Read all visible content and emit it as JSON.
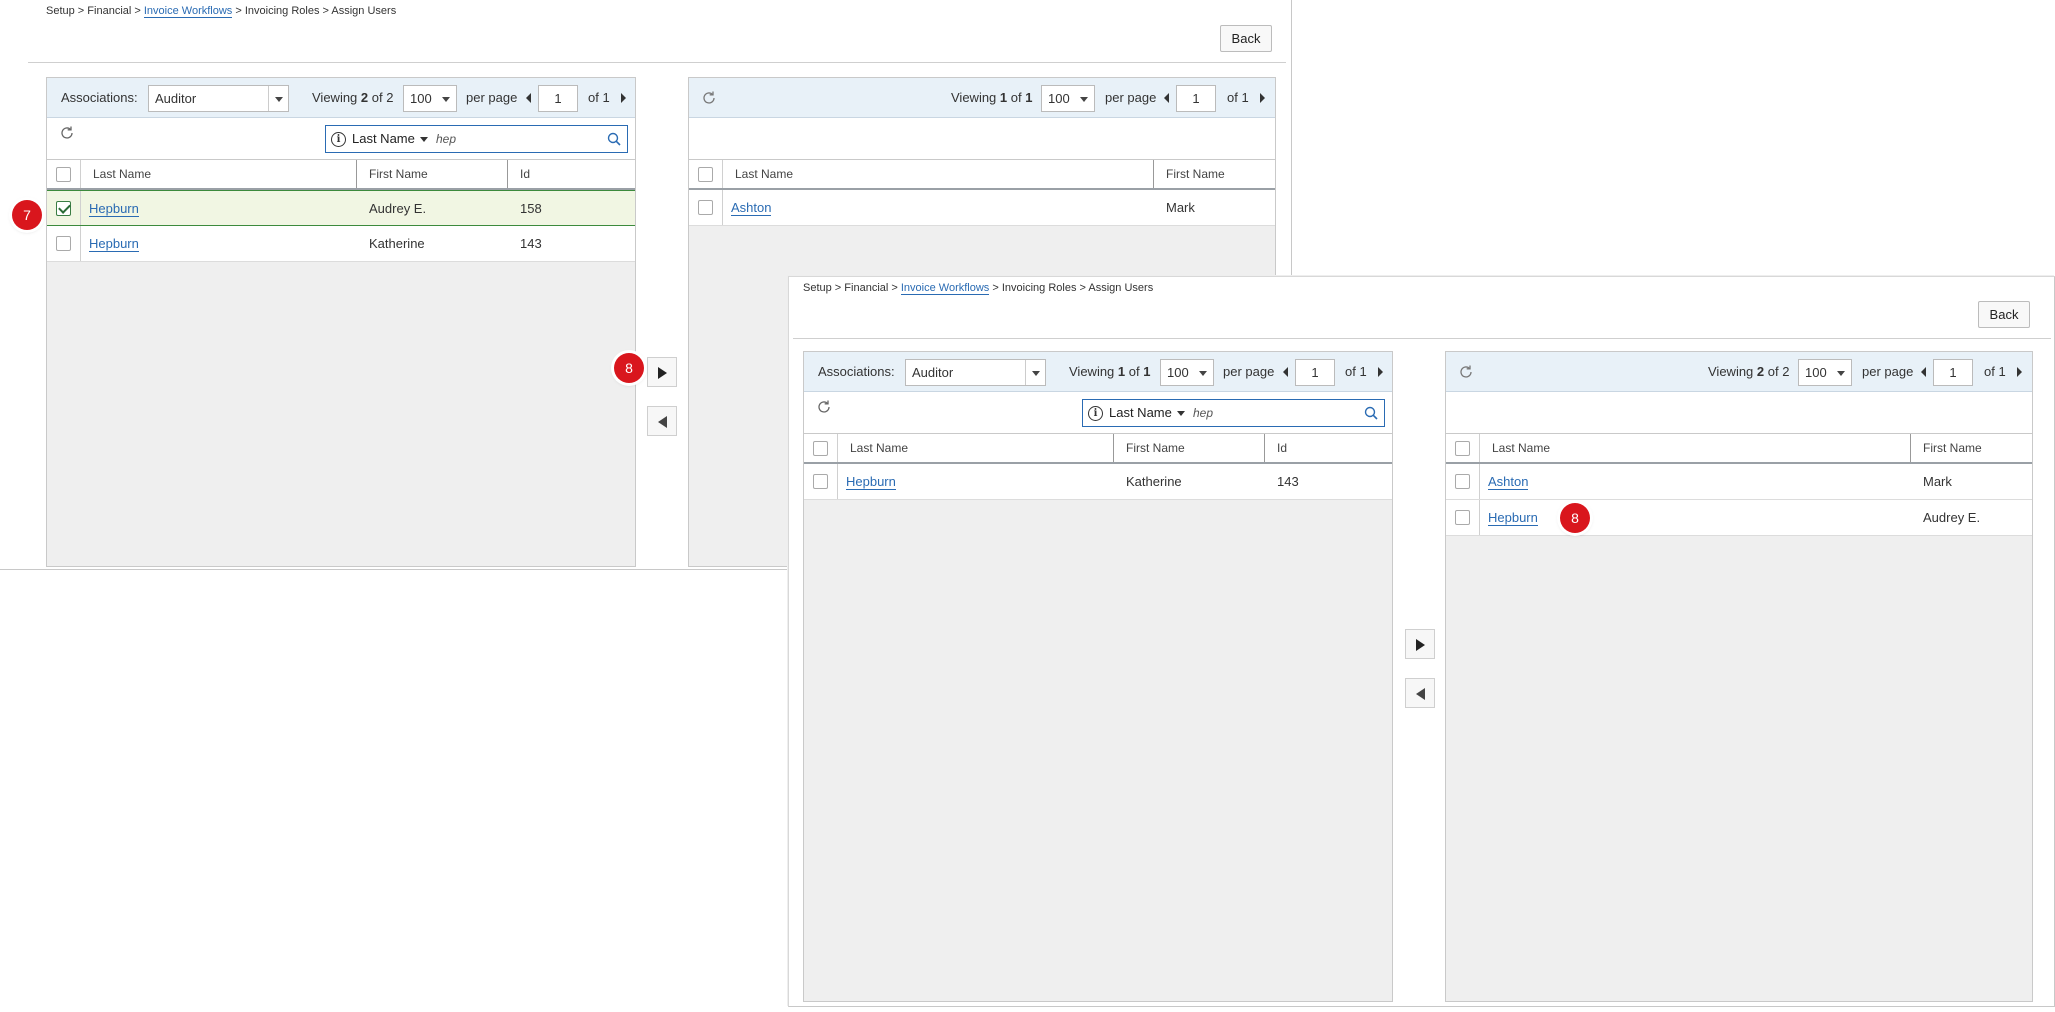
{
  "breadcrumb": {
    "setup": "Setup",
    "sep1": " > ",
    "financial": "Financial",
    "sep2": " > ",
    "invoice_workflows": "Invoice Workflows",
    "sep3": " > ",
    "invoicing_roles": "Invoicing Roles",
    "sep4": " > ",
    "assign_users": "Assign Users"
  },
  "back_label": "Back",
  "associations_label": "Associations:",
  "associations_value": "Auditor",
  "pager": {
    "viewing_label": "Viewing",
    "of_word": "of",
    "per_page_label": "per page",
    "per_page_value": "100",
    "page_value": "1",
    "page_of_text": "of 1"
  },
  "search": {
    "field": "Last Name",
    "query": "hep"
  },
  "columns": {
    "last_name": "Last Name",
    "first_name": "First Name",
    "id": "Id"
  },
  "step1": {
    "left": {
      "viewing_shown": "2",
      "viewing_total": "2",
      "rows": [
        {
          "last": "Hepburn",
          "first": "Audrey E.",
          "id": "158",
          "checked": true
        },
        {
          "last": "Hepburn",
          "first": "Katherine",
          "id": "143",
          "checked": false
        }
      ]
    },
    "right": {
      "viewing_shown": "1",
      "viewing_total": "1",
      "rows": [
        {
          "last": "Ashton",
          "first": "Mark"
        }
      ]
    },
    "badge_select": "7",
    "badge_move": "8"
  },
  "step2": {
    "left": {
      "viewing_shown": "1",
      "viewing_total": "1",
      "rows": [
        {
          "last": "Hepburn",
          "first": "Katherine",
          "id": "143"
        }
      ]
    },
    "right": {
      "viewing_shown": "2",
      "viewing_total": "2",
      "rows": [
        {
          "last": "Ashton",
          "first": "Mark"
        },
        {
          "last": "Hepburn",
          "first": "Audrey E."
        }
      ]
    },
    "badge_added": "8"
  },
  "colors": {
    "link": "#2a6bb3",
    "badge": "#d9161d",
    "header_bg": "#e8f1f8",
    "selected_row_bg": "#f1f6e3"
  },
  "icons": [
    "refresh-icon",
    "info-icon",
    "search-icon",
    "chevron-down-icon",
    "prev-page-icon",
    "next-page-icon",
    "move-right-icon",
    "move-left-icon",
    "checkbox-icon"
  ]
}
